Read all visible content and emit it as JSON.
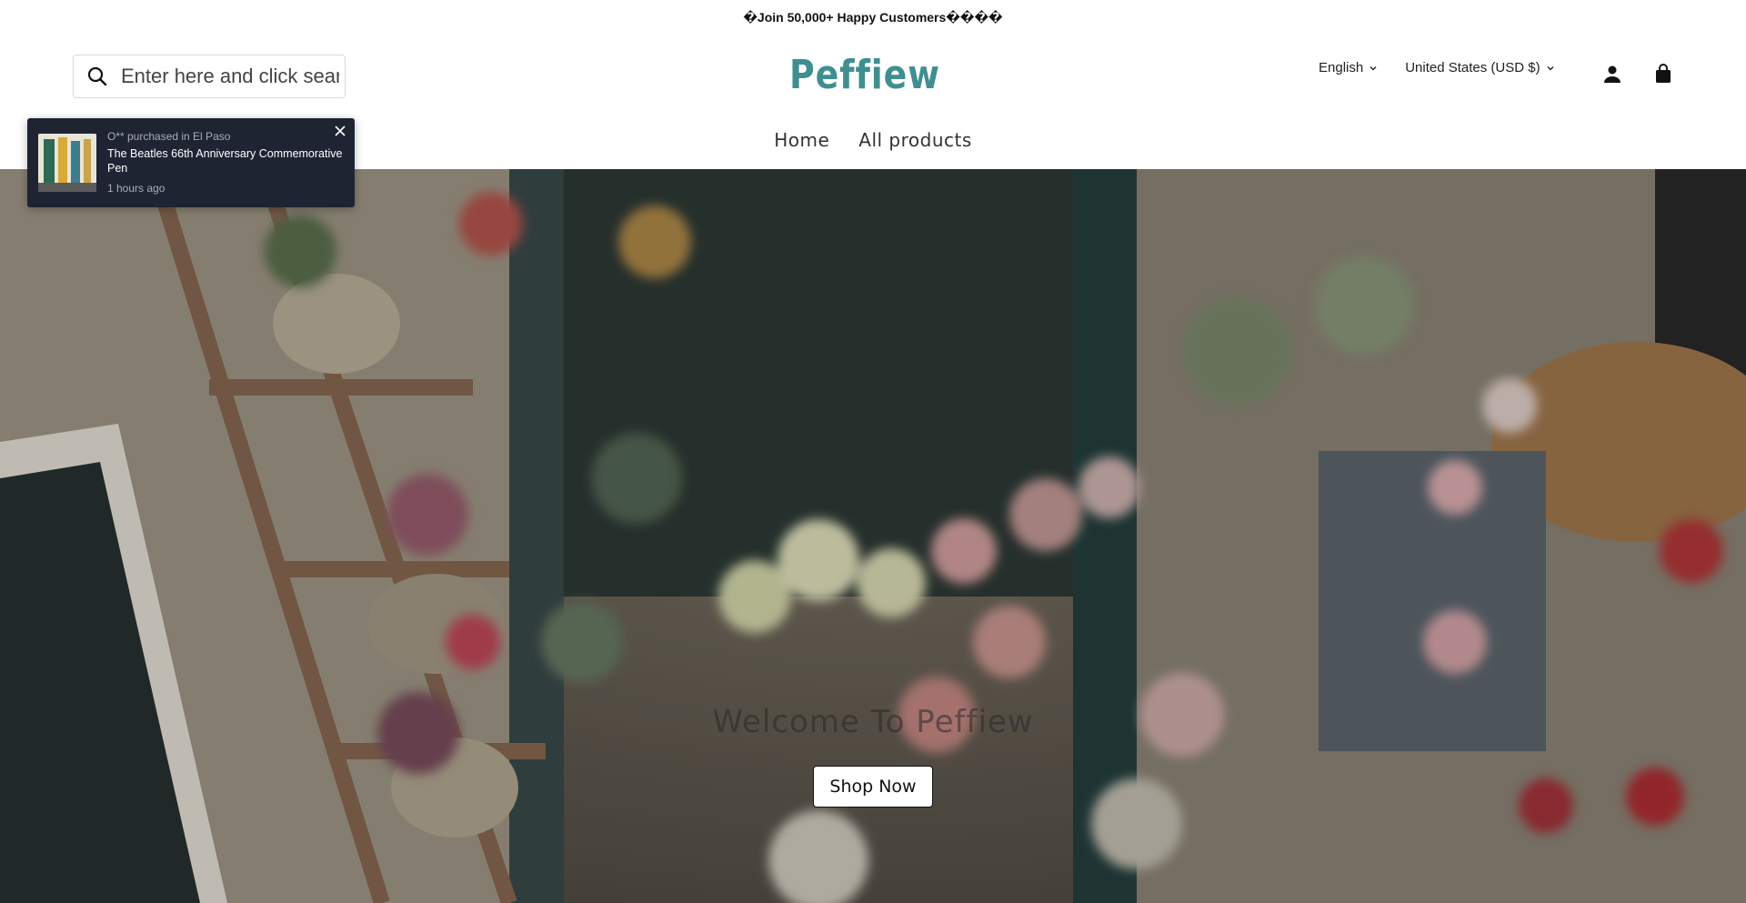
{
  "announcement": "�Join 50,000+ Happy Customers����",
  "search": {
    "placeholder": "Enter here and click search"
  },
  "brand": {
    "name": "Peffiew",
    "color": "#3f8f91"
  },
  "localization": {
    "language": "English",
    "country": "United States (USD $)"
  },
  "header_icons": [
    "account-icon",
    "cart-icon"
  ],
  "nav": [
    {
      "label": "Home"
    },
    {
      "label": "All products"
    }
  ],
  "popup": {
    "buyer": "O** purchased in El Paso",
    "product": "The Beatles 66th Anniversary Commemorative Pen",
    "time": "1 hours ago"
  },
  "hero": {
    "title": "Welcome To Peffiew",
    "button": "Shop Now"
  }
}
